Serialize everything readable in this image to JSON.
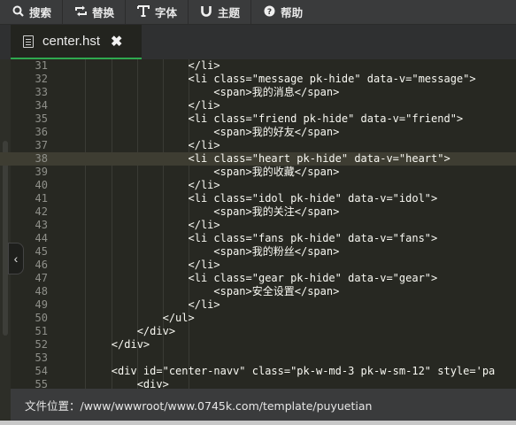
{
  "toolbar": {
    "search": {
      "icon": "search-icon",
      "label": "搜索"
    },
    "replace": {
      "icon": "replace-icon",
      "label": "替换"
    },
    "font": {
      "icon": "font-icon",
      "label": "字体"
    },
    "theme": {
      "icon": "theme-icon",
      "label": "主题"
    },
    "help": {
      "icon": "help-icon",
      "label": "帮助"
    }
  },
  "tab": {
    "filename": "center.hst",
    "close": "✖"
  },
  "editor": {
    "lines": [
      {
        "n": "31",
        "text": "                    </li>"
      },
      {
        "n": "32",
        "text": "                    <li class=\"message pk-hide\" data-v=\"message\">"
      },
      {
        "n": "33",
        "text": "                        <span>我的消息</span>"
      },
      {
        "n": "34",
        "text": "                    </li>"
      },
      {
        "n": "35",
        "text": "                    <li class=\"friend pk-hide\" data-v=\"friend\">"
      },
      {
        "n": "36",
        "text": "                        <span>我的好友</span>"
      },
      {
        "n": "37",
        "text": "                    </li>"
      },
      {
        "n": "38",
        "text": "                    <li class=\"heart pk-hide\" data-v=\"heart\">"
      },
      {
        "n": "39",
        "text": "                        <span>我的收藏</span>"
      },
      {
        "n": "40",
        "text": "                    </li>"
      },
      {
        "n": "41",
        "text": "                    <li class=\"idol pk-hide\" data-v=\"idol\">"
      },
      {
        "n": "42",
        "text": "                        <span>我的关注</span>"
      },
      {
        "n": "43",
        "text": "                    </li>"
      },
      {
        "n": "44",
        "text": "                    <li class=\"fans pk-hide\" data-v=\"fans\">"
      },
      {
        "n": "45",
        "text": "                        <span>我的粉丝</span>"
      },
      {
        "n": "46",
        "text": "                    </li>"
      },
      {
        "n": "47",
        "text": "                    <li class=\"gear pk-hide\" data-v=\"gear\">"
      },
      {
        "n": "48",
        "text": "                        <span>安全设置</span>"
      },
      {
        "n": "49",
        "text": "                    </li>"
      },
      {
        "n": "50",
        "text": "                </ul>"
      },
      {
        "n": "51",
        "text": "            </div>"
      },
      {
        "n": "52",
        "text": "        </div>"
      },
      {
        "n": "53",
        "text": ""
      },
      {
        "n": "54",
        "text": "        <div id=\"center-navv\" class=\"pk-w-md-3 pk-w-sm-12\" style='pa"
      },
      {
        "n": "55",
        "text": "            <div>"
      }
    ],
    "active_line": "38",
    "collapse_icon": "chevron-left-icon"
  },
  "status": {
    "label": "文件位置：/www/wwwroot/www.0745k.com/template/puyuetian"
  },
  "colors": {
    "accent": "#2fa84f",
    "editor_bg": "#272822",
    "toolbar_bg": "#3a3b3c"
  }
}
